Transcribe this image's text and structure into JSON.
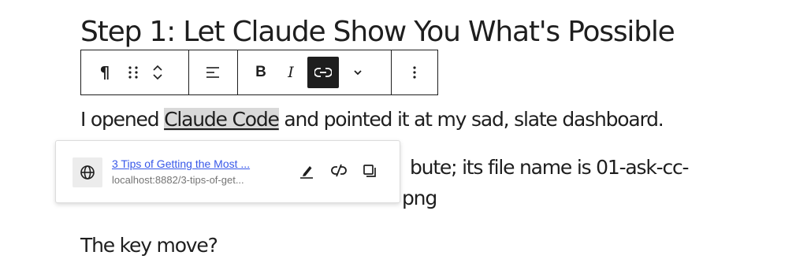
{
  "heading": "Step 1: Let Claude Show You What's Possible",
  "toolbar": {
    "paragraph_symbol": "¶",
    "bold_label": "B",
    "italic_label": "I"
  },
  "paragraph1": {
    "before": "I opened ",
    "link_text": "Claude Code",
    "after": " and pointed it at my sad, slate dashboard."
  },
  "paragraph2": {
    "visible_tail": "bute; its file name is 01-ask-cc-",
    "line2_tail": "png"
  },
  "paragraph3": "The key move?",
  "link_popover": {
    "title": "3 Tips of Getting the Most ...",
    "url": "localhost:8882/3-tips-of-get..."
  },
  "icons": [
    "paragraph-icon",
    "drag-handle-icon",
    "chevron-up-icon",
    "chevron-down-icon",
    "align-left-icon",
    "bold-icon",
    "italic-icon",
    "link-icon",
    "more-rich-text-icon",
    "options-icon",
    "globe-icon",
    "edit-pencil-icon",
    "unlink-icon",
    "copy-icon"
  ],
  "colors": {
    "text": "#1e1e1e",
    "link": "#3858e9",
    "highlight": "#d9d9d9",
    "muted": "#757575"
  }
}
